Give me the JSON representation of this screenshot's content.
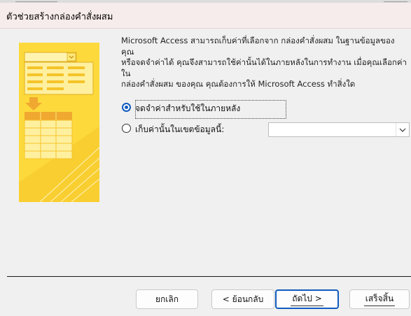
{
  "window": {
    "title": "ตัวช่วยสร้างกล่องคำสั่งผสม"
  },
  "description": "Microsoft Access สามารถเก็บค่าที่เลือกจาก กล่องคำสั่งผสม ในฐานข้อมูลของคุณ\nหรือจดจำค่าได้ คุณจึงสามารถใช้ค่านั้นได้ในภายหลังในการทำงาน เมื่อคุณเลือกค่าใน\nกล่องคำสั่งผสม ของคุณ คุณต้องการให้ Microsoft Access ทำสิ่งใด",
  "options": {
    "remember": {
      "label": "จดจำค่าสำหรับใช้ในภายหลัง",
      "checked": true
    },
    "store": {
      "label": "เก็บค่านั้นในเขตข้อมูลนี้:",
      "checked": false
    }
  },
  "field_combo": {
    "value": ""
  },
  "buttons": {
    "cancel": "ยกเลิก",
    "back": "< ย้อนกลับ",
    "next": "ถัดไป >",
    "finish": "เสร็จสิ้น"
  },
  "icons": {
    "illustration": "combo-wizard-illustration",
    "dropdown": "chevron-down-icon"
  },
  "colors": {
    "accent": "#0f5bbf",
    "illustration_yellow": "#fcd83c",
    "illustration_orange": "#f0a830",
    "titlebar": "#f7ecec"
  }
}
